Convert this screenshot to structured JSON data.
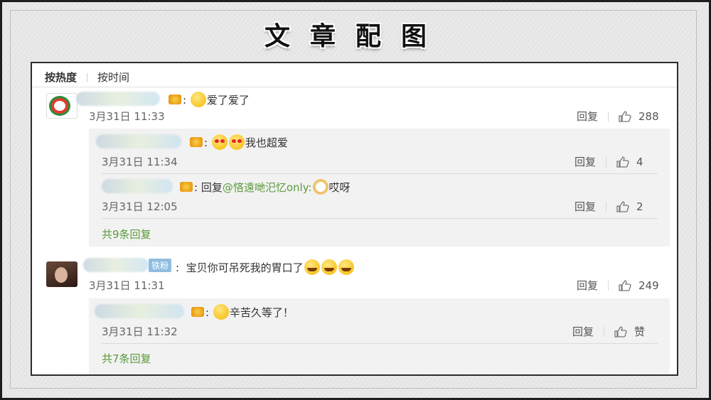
{
  "banner": {
    "title": "文章配图"
  },
  "tabs": {
    "hot": "按热度",
    "time": "按时间"
  },
  "comments": [
    {
      "text": "爱了爱了",
      "time": "3月31日 11:33",
      "reply_label": "回复",
      "likes": "288",
      "replies": [
        {
          "text": "我也超爱",
          "time": "3月31日 11:34",
          "reply_label": "回复",
          "likes": "4"
        },
        {
          "prefix": "回复",
          "mention": "@悋遠哋汜忆only:",
          "text": "哎呀",
          "time": "3月31日 12:05",
          "reply_label": "回复",
          "likes": "2"
        }
      ],
      "more": "共9条回复"
    },
    {
      "badge": "铁粉",
      "text": "宝贝你可吊死我的胃口了",
      "time": "3月31日 11:31",
      "reply_label": "回复",
      "likes": "249",
      "replies": [
        {
          "text": "辛苦久等了！",
          "time": "3月31日 11:32",
          "reply_label": "回复",
          "likes": "赞"
        }
      ],
      "more": "共7条回复"
    }
  ],
  "colors": {
    "link": "#5b9a3c",
    "text": "#333333",
    "reply_bg": "#f2f2f2"
  },
  "icons": [
    "thumb-up-icon",
    "vip-badge-icon",
    "emoji-icon"
  ]
}
